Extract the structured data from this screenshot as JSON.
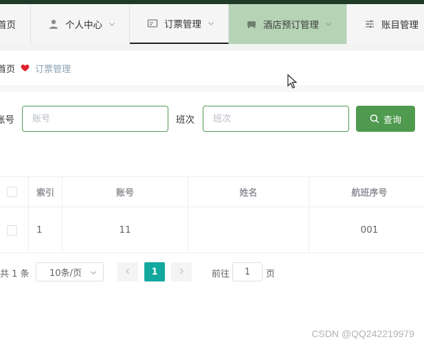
{
  "nav": {
    "items": [
      {
        "label": "首页"
      },
      {
        "label": "个人中心"
      },
      {
        "label": "订票管理"
      },
      {
        "label": "酒店预订管理"
      },
      {
        "label": "账目管理"
      }
    ]
  },
  "breadcrumb": {
    "home": "首页",
    "current": "订票管理"
  },
  "search": {
    "account_label": "账号",
    "account_placeholder": "账号",
    "shift_label": "班次",
    "shift_placeholder": "班次",
    "query_label": "查询"
  },
  "table": {
    "headers": {
      "index": "索引",
      "account": "账号",
      "name": "姓名",
      "flight_no": "航班序号"
    },
    "rows": [
      {
        "index": "1",
        "account": "11",
        "name": "",
        "flight_no": "001"
      }
    ]
  },
  "pagination": {
    "total": "共 1 条",
    "page_size": "10条/页",
    "current_page": "1",
    "goto_prefix": "前往",
    "goto_value": "1",
    "goto_suffix": "页"
  },
  "watermark": "CSDN @QQ242219979",
  "colors": {
    "primary": "#4f9a4f",
    "pager_active": "#13a89e",
    "nav_active_bg": "#b5d3b5",
    "heart": "#e0222e"
  }
}
